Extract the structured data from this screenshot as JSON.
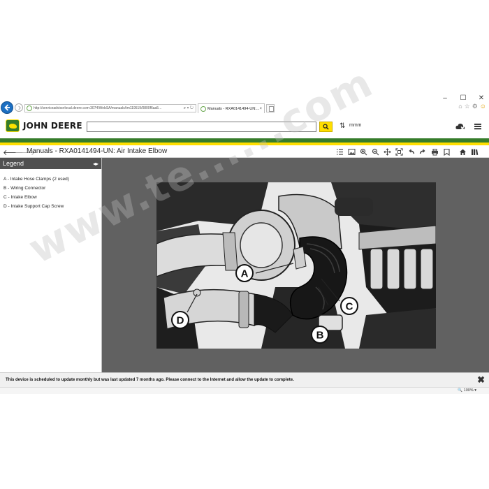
{
  "browser": {
    "address_url": "http://serviceadvisorlocal.deere.com:3074/WebSA/manuals/tm119519/0800f6aa5...",
    "address_controls": "⌕ ▾ ↻",
    "tab_title": "Manuals - RXA0141494-UN:...",
    "tab_close": "×",
    "window_controls": {
      "minimize": "–",
      "maximize": "☐",
      "close": "✕"
    },
    "icons": [
      "home-icon",
      "star-icon",
      "gear-icon",
      "smiley-icon"
    ]
  },
  "header": {
    "logo_text": "JOHN DEERE",
    "search_value": "",
    "units_label": "mmm",
    "colors": {
      "green": "#367c2b",
      "yellow": "#ffde00"
    }
  },
  "titlebar": {
    "back_symbol": "🡐",
    "forward_symbol": "🡒",
    "title": "Manuals - RXA0141494-UN: Air Intake Elbow",
    "toolbar": [
      "list-icon",
      "image-icon",
      "zoom-in-icon",
      "zoom-out-icon",
      "pan-icon",
      "fit-icon",
      "undo-icon",
      "redo-icon",
      "print-icon",
      "bookmark-icon",
      "home-icon",
      "library-icon"
    ]
  },
  "legend": {
    "header": "Legend",
    "collapse_symbol": "◂▸",
    "items": [
      "A - Intake Hose Clamps (2 used)",
      "B - Wiring Connector",
      "C - Intake Elbow",
      "D - Intake Support Cap Screw"
    ]
  },
  "illustration": {
    "callouts": [
      "A",
      "B",
      "C",
      "D"
    ]
  },
  "notice": {
    "text": "This device is scheduled to update monthly but was last updated 7 months ago. Please connect to the Internet and allow the update to complete.",
    "close_symbol": "✖"
  },
  "status": {
    "zoom": "🔍 100% ▾"
  },
  "watermark": {
    "text": "www.te......com"
  }
}
